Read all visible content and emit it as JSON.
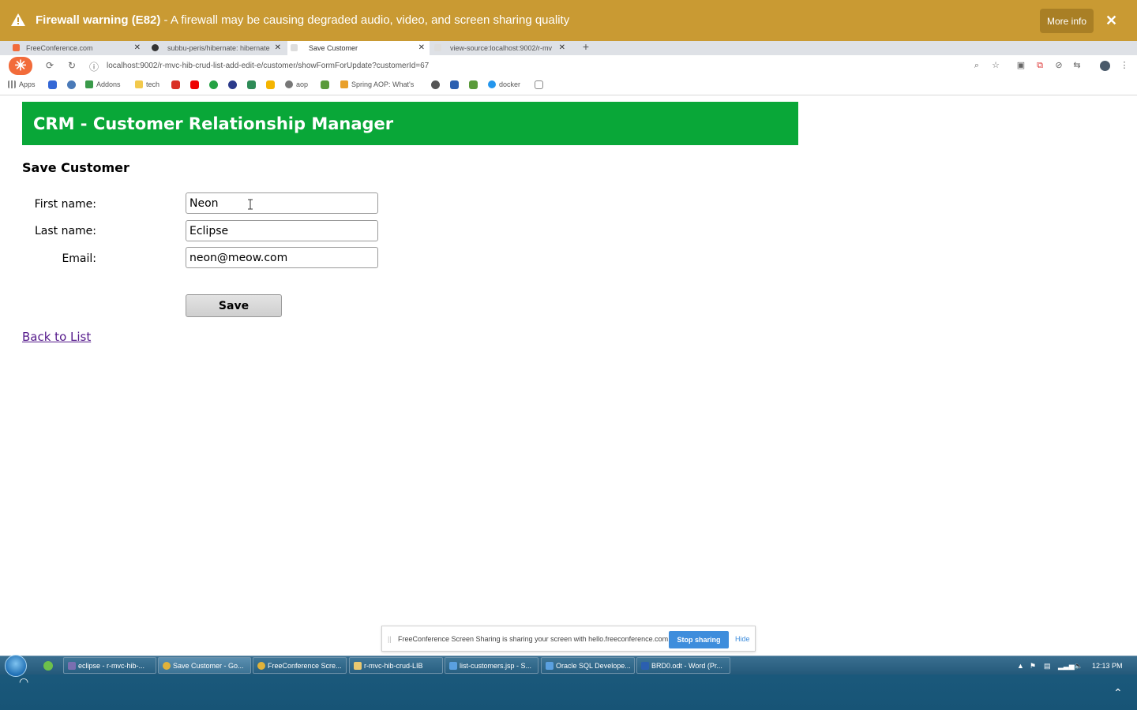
{
  "banner": {
    "title": "Firewall warning (E82)",
    "message": " - A firewall may be causing degraded audio, video, and screen sharing quality",
    "more_info": "More info",
    "close": "✕"
  },
  "tabs": [
    {
      "label": "FreeConference.com",
      "fav_color": "#f26b3a"
    },
    {
      "label": "subbu-peris/hibernate: hibernate",
      "fav_color": "#333333"
    },
    {
      "label": "Save Customer",
      "fav_color": "#bbbbbb"
    },
    {
      "label": "view-source:localhost:9002/r-mv",
      "fav_color": "#bbbbbb"
    }
  ],
  "address": {
    "url": "localhost:9002/r-mvc-hib-crud-list-add-edit-e/customer/showFormForUpdate?customerId=67"
  },
  "bookmarks": {
    "apps": "Apps",
    "addons": "Addons",
    "tech": "tech",
    "aop": "aop",
    "spring": "Spring AOP: What's",
    "docker": "docker"
  },
  "page": {
    "header": "CRM - Customer Relationship Manager",
    "title": "Save Customer",
    "form": {
      "first_name_label": "First name:",
      "first_name_value": "Neon",
      "last_name_label": "Last name:",
      "last_name_value": "Eclipse",
      "email_label": "Email:",
      "email_value": "neon@meow.com",
      "save_label": "Save"
    },
    "back_link": "Back to List"
  },
  "share_bar": {
    "message": "FreeConference Screen Sharing is sharing your screen with hello.freeconference.com.",
    "stop": "Stop sharing",
    "hide": "Hide"
  },
  "taskbar": {
    "items": [
      {
        "label": "eclipse - r-mvc-hib-...",
        "color": "#7a6fb0"
      },
      {
        "label": "Save Customer - Go...",
        "color": "#e0b23a"
      },
      {
        "label": "FreeConference Scre...",
        "color": "#e0b23a"
      },
      {
        "label": "r-mvc-hib-crud-LIB",
        "color": "#e8c870"
      },
      {
        "label": "list-customers.jsp - S...",
        "color": "#5aa0e0"
      },
      {
        "label": "Oracle SQL Develope...",
        "color": "#5aa0e0"
      },
      {
        "label": "BRD0.odt - Word (Pr...",
        "color": "#2b5fb0"
      }
    ],
    "clock": "12:13 PM"
  },
  "colors": {
    "banner": "#c99a33",
    "header_green": "#09a738",
    "link": "#551a8b",
    "stop_button": "#3e8ddc"
  }
}
